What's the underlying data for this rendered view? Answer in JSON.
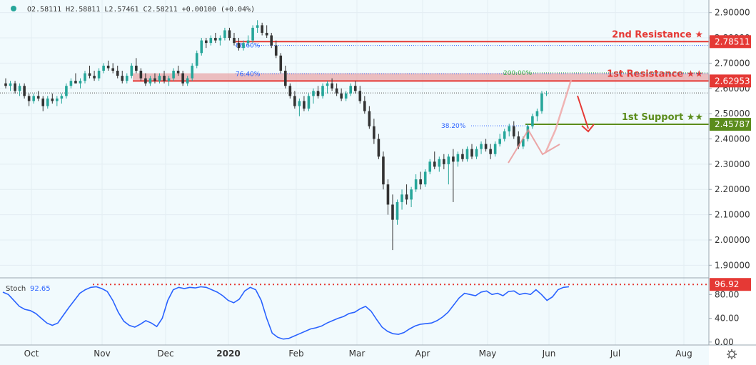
{
  "header": {
    "ohlc": "O2.58111 H2.58811 L2.57461 C2.58211 +0.00100 (+0.04%)"
  },
  "chart_data": {
    "type": "candlestick",
    "price_axis": {
      "ylim": [
        1.85,
        2.95
      ],
      "ticks": [
        1.9,
        2.0,
        2.1,
        2.2,
        2.3,
        2.4,
        2.5,
        2.6,
        2.7,
        2.8,
        2.9
      ],
      "tick_labels": [
        "1.90000",
        "2.00000",
        "2.10000",
        "2.20000",
        "2.30000",
        "2.40000",
        "2.50000",
        "2.60000",
        "2.70000",
        "2.80000",
        "2.90000"
      ]
    },
    "x_axis": {
      "labels": [
        "Oct",
        "Nov",
        "Dec",
        "2020",
        "Feb",
        "Mar",
        "Apr",
        "May",
        "Jun",
        "Jul",
        "Aug"
      ]
    },
    "levels": [
      {
        "name": "2nd Resistance ★",
        "value": 2.78511,
        "label": "2.78511",
        "color": "#e53935"
      },
      {
        "name": "1st Resistance ★★",
        "value": 2.62953,
        "label": "2.62953",
        "color": "#e53935"
      },
      {
        "name": "1st Support ★★",
        "value": 2.45787,
        "label": "2.45787",
        "color": "#5b8c1c"
      }
    ],
    "resistance_zone": [
      2.62953,
      2.66
    ],
    "fib_labels": [
      {
        "text": "88.60%",
        "value": 2.77
      },
      {
        "text": "76.40%",
        "value": 2.658
      },
      {
        "text": "200.00%",
        "value": 2.662
      },
      {
        "text": "38.20%",
        "value": 2.452
      }
    ],
    "current_price": 2.58211,
    "up_color": "#26a69a",
    "down_color": "#333333",
    "candles": [
      [
        2.62,
        2.64,
        2.6,
        2.61
      ],
      [
        2.61,
        2.63,
        2.59,
        2.62
      ],
      [
        2.62,
        2.63,
        2.58,
        2.59
      ],
      [
        2.59,
        2.62,
        2.57,
        2.61
      ],
      [
        2.61,
        2.62,
        2.56,
        2.57
      ],
      [
        2.57,
        2.58,
        2.53,
        2.55
      ],
      [
        2.55,
        2.58,
        2.54,
        2.57
      ],
      [
        2.57,
        2.59,
        2.55,
        2.56
      ],
      [
        2.56,
        2.57,
        2.51,
        2.53
      ],
      [
        2.53,
        2.57,
        2.52,
        2.56
      ],
      [
        2.56,
        2.58,
        2.54,
        2.55
      ],
      [
        2.55,
        2.57,
        2.53,
        2.56
      ],
      [
        2.56,
        2.58,
        2.54,
        2.57
      ],
      [
        2.57,
        2.62,
        2.56,
        2.61
      ],
      [
        2.61,
        2.64,
        2.6,
        2.63
      ],
      [
        2.63,
        2.66,
        2.62,
        2.62
      ],
      [
        2.62,
        2.64,
        2.6,
        2.63
      ],
      [
        2.63,
        2.67,
        2.62,
        2.66
      ],
      [
        2.66,
        2.69,
        2.64,
        2.65
      ],
      [
        2.65,
        2.67,
        2.63,
        2.64
      ],
      [
        2.64,
        2.68,
        2.63,
        2.67
      ],
      [
        2.67,
        2.7,
        2.66,
        2.69
      ],
      [
        2.69,
        2.71,
        2.67,
        2.68
      ],
      [
        2.68,
        2.7,
        2.66,
        2.67
      ],
      [
        2.67,
        2.69,
        2.64,
        2.65
      ],
      [
        2.65,
        2.67,
        2.62,
        2.63
      ],
      [
        2.63,
        2.66,
        2.62,
        2.65
      ],
      [
        2.65,
        2.7,
        2.64,
        2.69
      ],
      [
        2.69,
        2.72,
        2.66,
        2.67
      ],
      [
        2.67,
        2.68,
        2.63,
        2.64
      ],
      [
        2.64,
        2.66,
        2.61,
        2.62
      ],
      [
        2.62,
        2.65,
        2.61,
        2.64
      ],
      [
        2.64,
        2.66,
        2.62,
        2.63
      ],
      [
        2.63,
        2.66,
        2.62,
        2.65
      ],
      [
        2.65,
        2.67,
        2.62,
        2.63
      ],
      [
        2.63,
        2.65,
        2.61,
        2.64
      ],
      [
        2.64,
        2.68,
        2.63,
        2.67
      ],
      [
        2.67,
        2.69,
        2.65,
        2.66
      ],
      [
        2.66,
        2.67,
        2.61,
        2.62
      ],
      [
        2.62,
        2.65,
        2.61,
        2.64
      ],
      [
        2.64,
        2.7,
        2.63,
        2.69
      ],
      [
        2.69,
        2.75,
        2.68,
        2.74
      ],
      [
        2.74,
        2.8,
        2.73,
        2.79
      ],
      [
        2.79,
        2.8,
        2.76,
        2.78
      ],
      [
        2.78,
        2.81,
        2.77,
        2.8
      ],
      [
        2.8,
        2.82,
        2.78,
        2.79
      ],
      [
        2.79,
        2.81,
        2.77,
        2.8
      ],
      [
        2.8,
        2.84,
        2.79,
        2.83
      ],
      [
        2.83,
        2.84,
        2.79,
        2.8
      ],
      [
        2.8,
        2.82,
        2.77,
        2.78
      ],
      [
        2.78,
        2.8,
        2.75,
        2.76
      ],
      [
        2.76,
        2.79,
        2.75,
        2.78
      ],
      [
        2.78,
        2.81,
        2.77,
        2.79
      ],
      [
        2.79,
        2.85,
        2.78,
        2.84
      ],
      [
        2.84,
        2.87,
        2.82,
        2.85
      ],
      [
        2.85,
        2.86,
        2.81,
        2.82
      ],
      [
        2.82,
        2.85,
        2.8,
        2.81
      ],
      [
        2.81,
        2.82,
        2.76,
        2.77
      ],
      [
        2.77,
        2.79,
        2.72,
        2.73
      ],
      [
        2.73,
        2.74,
        2.66,
        2.67
      ],
      [
        2.67,
        2.69,
        2.6,
        2.61
      ],
      [
        2.61,
        2.62,
        2.56,
        2.57
      ],
      [
        2.57,
        2.59,
        2.52,
        2.53
      ],
      [
        2.53,
        2.56,
        2.49,
        2.55
      ],
      [
        2.55,
        2.57,
        2.51,
        2.52
      ],
      [
        2.52,
        2.58,
        2.51,
        2.57
      ],
      [
        2.57,
        2.6,
        2.54,
        2.59
      ],
      [
        2.59,
        2.61,
        2.56,
        2.57
      ],
      [
        2.57,
        2.62,
        2.56,
        2.61
      ],
      [
        2.61,
        2.63,
        2.58,
        2.62
      ],
      [
        2.62,
        2.64,
        2.59,
        2.6
      ],
      [
        2.6,
        2.62,
        2.57,
        2.58
      ],
      [
        2.58,
        2.6,
        2.55,
        2.56
      ],
      [
        2.56,
        2.59,
        2.55,
        2.58
      ],
      [
        2.58,
        2.62,
        2.57,
        2.61
      ],
      [
        2.61,
        2.63,
        2.58,
        2.59
      ],
      [
        2.59,
        2.61,
        2.54,
        2.55
      ],
      [
        2.55,
        2.57,
        2.5,
        2.51
      ],
      [
        2.51,
        2.53,
        2.44,
        2.45
      ],
      [
        2.45,
        2.48,
        2.38,
        2.4
      ],
      [
        2.4,
        2.42,
        2.32,
        2.33
      ],
      [
        2.33,
        2.35,
        2.2,
        2.22
      ],
      [
        2.22,
        2.24,
        2.1,
        2.14
      ],
      [
        2.14,
        2.18,
        1.96,
        2.08
      ],
      [
        2.08,
        2.16,
        2.06,
        2.15
      ],
      [
        2.15,
        2.2,
        2.12,
        2.18
      ],
      [
        2.18,
        2.22,
        2.14,
        2.16
      ],
      [
        2.16,
        2.21,
        2.13,
        2.2
      ],
      [
        2.2,
        2.26,
        2.19,
        2.24
      ],
      [
        2.24,
        2.27,
        2.2,
        2.22
      ],
      [
        2.22,
        2.28,
        2.21,
        2.27
      ],
      [
        2.27,
        2.32,
        2.26,
        2.31
      ],
      [
        2.31,
        2.35,
        2.28,
        2.29
      ],
      [
        2.29,
        2.33,
        2.27,
        2.32
      ],
      [
        2.32,
        2.34,
        2.28,
        2.3
      ],
      [
        2.3,
        2.34,
        2.22,
        2.33
      ],
      [
        2.33,
        2.36,
        2.15,
        2.31
      ],
      [
        2.31,
        2.35,
        2.29,
        2.34
      ],
      [
        2.34,
        2.36,
        2.31,
        2.32
      ],
      [
        2.32,
        2.37,
        2.31,
        2.36
      ],
      [
        2.36,
        2.38,
        2.32,
        2.33
      ],
      [
        2.33,
        2.37,
        2.32,
        2.36
      ],
      [
        2.36,
        2.39,
        2.34,
        2.38
      ],
      [
        2.38,
        2.4,
        2.35,
        2.36
      ],
      [
        2.36,
        2.38,
        2.32,
        2.34
      ],
      [
        2.34,
        2.39,
        2.33,
        2.38
      ],
      [
        2.38,
        2.42,
        2.37,
        2.4
      ],
      [
        2.4,
        2.44,
        2.39,
        2.43
      ],
      [
        2.43,
        2.46,
        2.41,
        2.45
      ],
      [
        2.45,
        2.47,
        2.4,
        2.41
      ],
      [
        2.41,
        2.43,
        2.36,
        2.37
      ],
      [
        2.37,
        2.41,
        2.36,
        2.4
      ],
      [
        2.4,
        2.46,
        2.39,
        2.45
      ],
      [
        2.45,
        2.5,
        2.44,
        2.49
      ],
      [
        2.49,
        2.52,
        2.47,
        2.51
      ],
      [
        2.51,
        2.59,
        2.5,
        2.58
      ],
      [
        2.58,
        2.59,
        2.57,
        2.58
      ]
    ]
  },
  "stoch": {
    "label": "Stoch",
    "value_label": "92.65",
    "level": 96.92,
    "level_label": "96.92",
    "ylim": [
      -5,
      108
    ],
    "ticks": [
      0,
      40,
      80
    ],
    "tick_labels": [
      "0.00",
      "40.00",
      "80.00"
    ],
    "line_color": "#2962ff",
    "values": [
      84,
      80,
      70,
      60,
      55,
      53,
      48,
      40,
      32,
      28,
      32,
      45,
      58,
      70,
      82,
      88,
      92,
      93,
      90,
      85,
      70,
      50,
      35,
      28,
      25,
      30,
      36,
      32,
      26,
      40,
      70,
      88,
      92,
      90,
      92,
      91,
      93,
      92,
      88,
      84,
      78,
      70,
      66,
      72,
      86,
      92,
      88,
      70,
      40,
      15,
      8,
      5,
      6,
      10,
      14,
      18,
      22,
      24,
      27,
      32,
      36,
      40,
      43,
      48,
      50,
      56,
      60,
      52,
      38,
      25,
      18,
      14,
      13,
      16,
      22,
      27,
      30,
      31,
      32,
      36,
      42,
      50,
      62,
      74,
      82,
      80,
      78,
      84,
      86,
      80,
      82,
      78,
      85,
      86,
      80,
      82,
      80,
      88,
      80,
      70,
      76,
      88,
      92,
      93
    ]
  },
  "settings_icon": "gear-icon"
}
